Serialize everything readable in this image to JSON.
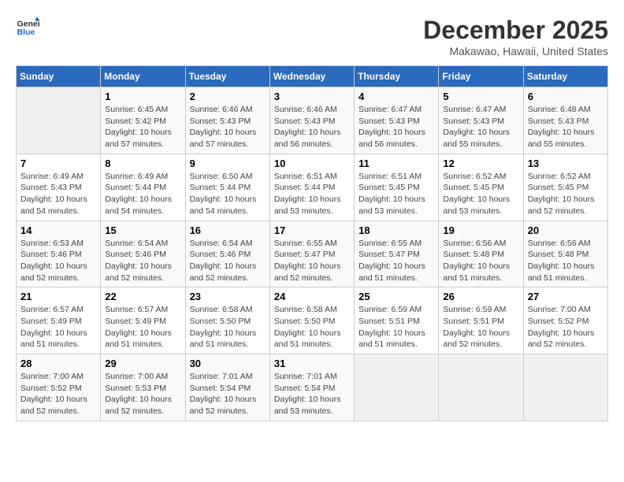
{
  "logo": {
    "line1": "General",
    "line2": "Blue"
  },
  "title": "December 2025",
  "location": "Makawao, Hawaii, United States",
  "days_header": [
    "Sunday",
    "Monday",
    "Tuesday",
    "Wednesday",
    "Thursday",
    "Friday",
    "Saturday"
  ],
  "weeks": [
    [
      {
        "day": "",
        "info": ""
      },
      {
        "day": "1",
        "info": "Sunrise: 6:45 AM\nSunset: 5:42 PM\nDaylight: 10 hours\nand 57 minutes."
      },
      {
        "day": "2",
        "info": "Sunrise: 6:46 AM\nSunset: 5:43 PM\nDaylight: 10 hours\nand 57 minutes."
      },
      {
        "day": "3",
        "info": "Sunrise: 6:46 AM\nSunset: 5:43 PM\nDaylight: 10 hours\nand 56 minutes."
      },
      {
        "day": "4",
        "info": "Sunrise: 6:47 AM\nSunset: 5:43 PM\nDaylight: 10 hours\nand 56 minutes."
      },
      {
        "day": "5",
        "info": "Sunrise: 6:47 AM\nSunset: 5:43 PM\nDaylight: 10 hours\nand 55 minutes."
      },
      {
        "day": "6",
        "info": "Sunrise: 6:48 AM\nSunset: 5:43 PM\nDaylight: 10 hours\nand 55 minutes."
      }
    ],
    [
      {
        "day": "7",
        "info": "Sunrise: 6:49 AM\nSunset: 5:43 PM\nDaylight: 10 hours\nand 54 minutes."
      },
      {
        "day": "8",
        "info": "Sunrise: 6:49 AM\nSunset: 5:44 PM\nDaylight: 10 hours\nand 54 minutes."
      },
      {
        "day": "9",
        "info": "Sunrise: 6:50 AM\nSunset: 5:44 PM\nDaylight: 10 hours\nand 54 minutes."
      },
      {
        "day": "10",
        "info": "Sunrise: 6:51 AM\nSunset: 5:44 PM\nDaylight: 10 hours\nand 53 minutes."
      },
      {
        "day": "11",
        "info": "Sunrise: 6:51 AM\nSunset: 5:45 PM\nDaylight: 10 hours\nand 53 minutes."
      },
      {
        "day": "12",
        "info": "Sunrise: 6:52 AM\nSunset: 5:45 PM\nDaylight: 10 hours\nand 53 minutes."
      },
      {
        "day": "13",
        "info": "Sunrise: 6:52 AM\nSunset: 5:45 PM\nDaylight: 10 hours\nand 52 minutes."
      }
    ],
    [
      {
        "day": "14",
        "info": "Sunrise: 6:53 AM\nSunset: 5:46 PM\nDaylight: 10 hours\nand 52 minutes."
      },
      {
        "day": "15",
        "info": "Sunrise: 6:54 AM\nSunset: 5:46 PM\nDaylight: 10 hours\nand 52 minutes."
      },
      {
        "day": "16",
        "info": "Sunrise: 6:54 AM\nSunset: 5:46 PM\nDaylight: 10 hours\nand 52 minutes."
      },
      {
        "day": "17",
        "info": "Sunrise: 6:55 AM\nSunset: 5:47 PM\nDaylight: 10 hours\nand 52 minutes."
      },
      {
        "day": "18",
        "info": "Sunrise: 6:55 AM\nSunset: 5:47 PM\nDaylight: 10 hours\nand 51 minutes."
      },
      {
        "day": "19",
        "info": "Sunrise: 6:56 AM\nSunset: 5:48 PM\nDaylight: 10 hours\nand 51 minutes."
      },
      {
        "day": "20",
        "info": "Sunrise: 6:56 AM\nSunset: 5:48 PM\nDaylight: 10 hours\nand 51 minutes."
      }
    ],
    [
      {
        "day": "21",
        "info": "Sunrise: 6:57 AM\nSunset: 5:49 PM\nDaylight: 10 hours\nand 51 minutes."
      },
      {
        "day": "22",
        "info": "Sunrise: 6:57 AM\nSunset: 5:49 PM\nDaylight: 10 hours\nand 51 minutes."
      },
      {
        "day": "23",
        "info": "Sunrise: 6:58 AM\nSunset: 5:50 PM\nDaylight: 10 hours\nand 51 minutes."
      },
      {
        "day": "24",
        "info": "Sunrise: 6:58 AM\nSunset: 5:50 PM\nDaylight: 10 hours\nand 51 minutes."
      },
      {
        "day": "25",
        "info": "Sunrise: 6:59 AM\nSunset: 5:51 PM\nDaylight: 10 hours\nand 51 minutes."
      },
      {
        "day": "26",
        "info": "Sunrise: 6:59 AM\nSunset: 5:51 PM\nDaylight: 10 hours\nand 52 minutes."
      },
      {
        "day": "27",
        "info": "Sunrise: 7:00 AM\nSunset: 5:52 PM\nDaylight: 10 hours\nand 52 minutes."
      }
    ],
    [
      {
        "day": "28",
        "info": "Sunrise: 7:00 AM\nSunset: 5:52 PM\nDaylight: 10 hours\nand 52 minutes."
      },
      {
        "day": "29",
        "info": "Sunrise: 7:00 AM\nSunset: 5:53 PM\nDaylight: 10 hours\nand 52 minutes."
      },
      {
        "day": "30",
        "info": "Sunrise: 7:01 AM\nSunset: 5:54 PM\nDaylight: 10 hours\nand 52 minutes."
      },
      {
        "day": "31",
        "info": "Sunrise: 7:01 AM\nSunset: 5:54 PM\nDaylight: 10 hours\nand 53 minutes."
      },
      {
        "day": "",
        "info": ""
      },
      {
        "day": "",
        "info": ""
      },
      {
        "day": "",
        "info": ""
      }
    ]
  ]
}
